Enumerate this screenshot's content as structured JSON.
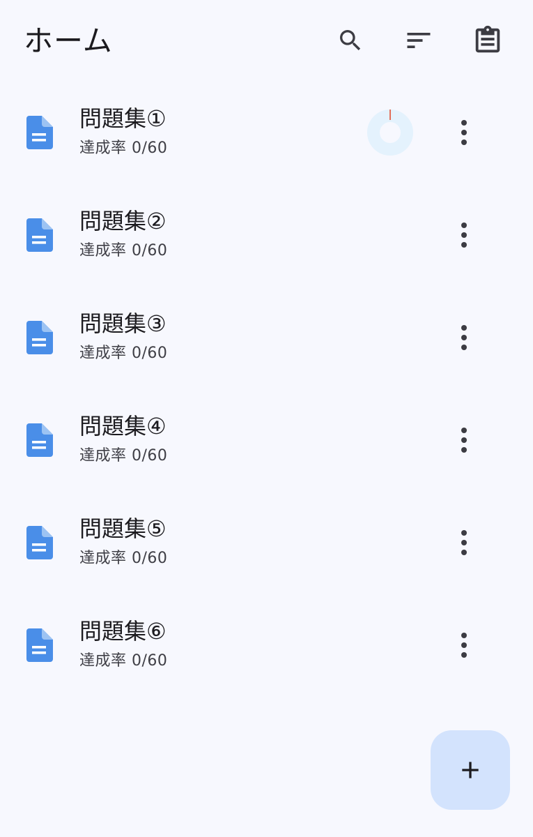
{
  "app_bar": {
    "title": "ホーム",
    "actions": [
      {
        "name": "search",
        "icon": "search-icon"
      },
      {
        "name": "sort",
        "icon": "sort-icon"
      },
      {
        "name": "clipboard",
        "icon": "clipboard-icon"
      }
    ]
  },
  "items": [
    {
      "title": "問題集①",
      "subtitle": "達成率 0/60",
      "icon": "document-icon",
      "show_progress_ring": true,
      "progress_fraction": 0
    },
    {
      "title": "問題集②",
      "subtitle": "達成率 0/60",
      "icon": "document-icon"
    },
    {
      "title": "問題集③",
      "subtitle": "達成率 0/60",
      "icon": "document-icon"
    },
    {
      "title": "問題集④",
      "subtitle": "達成率 0/60",
      "icon": "document-icon"
    },
    {
      "title": "問題集⑤",
      "subtitle": "達成率 0/60",
      "icon": "document-icon"
    },
    {
      "title": "問題集⑥",
      "subtitle": "達成率 0/60",
      "icon": "document-icon"
    }
  ],
  "fab": {
    "icon": "plus-icon"
  },
  "colors": {
    "background": "#f7f8fe",
    "doc_icon": "#4a8ee8",
    "icon_dark": "#3c3c43",
    "fab_background": "#d3e3fd",
    "ring_track": "#e4f2fd",
    "ring_marker": "#e26f5a"
  }
}
